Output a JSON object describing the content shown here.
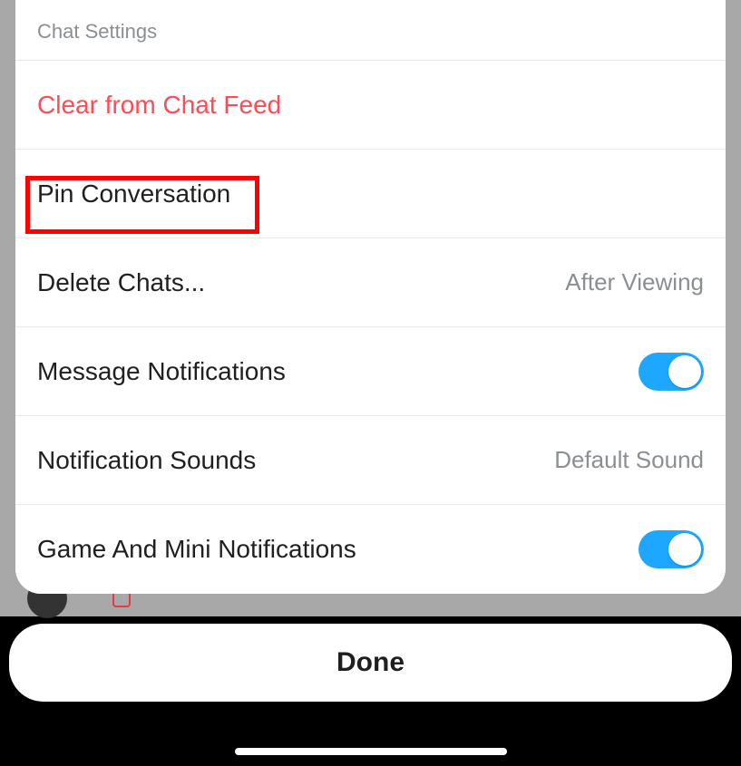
{
  "header": {
    "title": "Chat Settings"
  },
  "rows": {
    "clear": {
      "label": "Clear from Chat Feed"
    },
    "pin": {
      "label": "Pin Conversation"
    },
    "delete": {
      "label": "Delete Chats...",
      "value": "After Viewing"
    },
    "msgNotifs": {
      "label": "Message Notifications",
      "toggled": true
    },
    "notifSounds": {
      "label": "Notification Sounds",
      "value": "Default Sound"
    },
    "gameNotifs": {
      "label": "Game And Mini Notifications",
      "toggled": true
    }
  },
  "done": {
    "label": "Done"
  },
  "highlight": {
    "target": "pin-conversation-row"
  }
}
